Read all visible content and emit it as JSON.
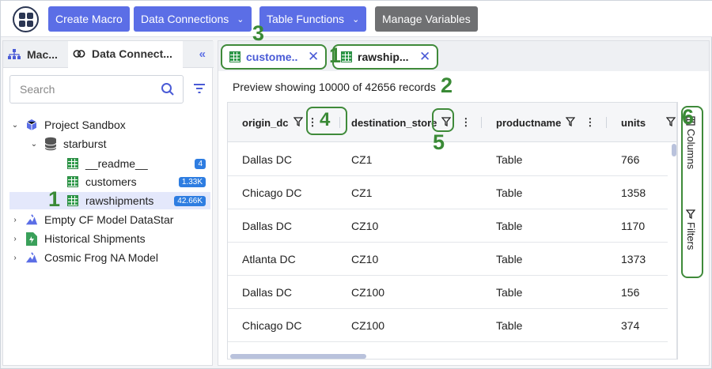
{
  "toolbar": {
    "create_macro": "Create Macro",
    "data_connections": "Data Connections",
    "table_functions": "Table Functions",
    "manage_variables": "Manage Variables",
    "colors": {
      "primary": "#5b6ee6",
      "gray": "#6f7072"
    }
  },
  "left_panel": {
    "tabs": [
      {
        "label": "Mac..."
      },
      {
        "label": "Data Connect..."
      }
    ],
    "search_placeholder": "Search",
    "tree": [
      {
        "label": "Project Sandbox",
        "icon": "cube-icon"
      },
      {
        "label": "starburst",
        "icon": "database-icon"
      },
      {
        "label": "__readme__",
        "badge": "4"
      },
      {
        "label": "customers",
        "badge": "1.33K"
      },
      {
        "label": "rawshipments",
        "badge": "42.66K"
      },
      {
        "label": "Empty CF Model DataStar",
        "icon": "model-icon"
      },
      {
        "label": "Historical Shipments",
        "icon": "file-icon"
      },
      {
        "label": "Cosmic Frog NA Model",
        "icon": "model-icon"
      }
    ]
  },
  "main": {
    "tabs": [
      {
        "label": "custome..."
      },
      {
        "label": "rawship..."
      }
    ],
    "preview_text": "Preview showing 10000 of 42656 records",
    "columns": [
      "origin_dc",
      "destination_store",
      "productname",
      "units"
    ],
    "rows": [
      [
        "Dallas DC",
        "CZ1",
        "Table",
        "766"
      ],
      [
        "Chicago DC",
        "CZ1",
        "Table",
        "1358"
      ],
      [
        "Dallas DC",
        "CZ10",
        "Table",
        "1170"
      ],
      [
        "Atlanta DC",
        "CZ10",
        "Table",
        "1373"
      ],
      [
        "Dallas DC",
        "CZ100",
        "Table",
        "156"
      ],
      [
        "Chicago DC",
        "CZ100",
        "Table",
        "374"
      ]
    ],
    "side_columns": "Columns",
    "side_filters": "Filters"
  },
  "annotations": [
    "1",
    "1",
    "2",
    "3",
    "4",
    "5",
    "6"
  ]
}
